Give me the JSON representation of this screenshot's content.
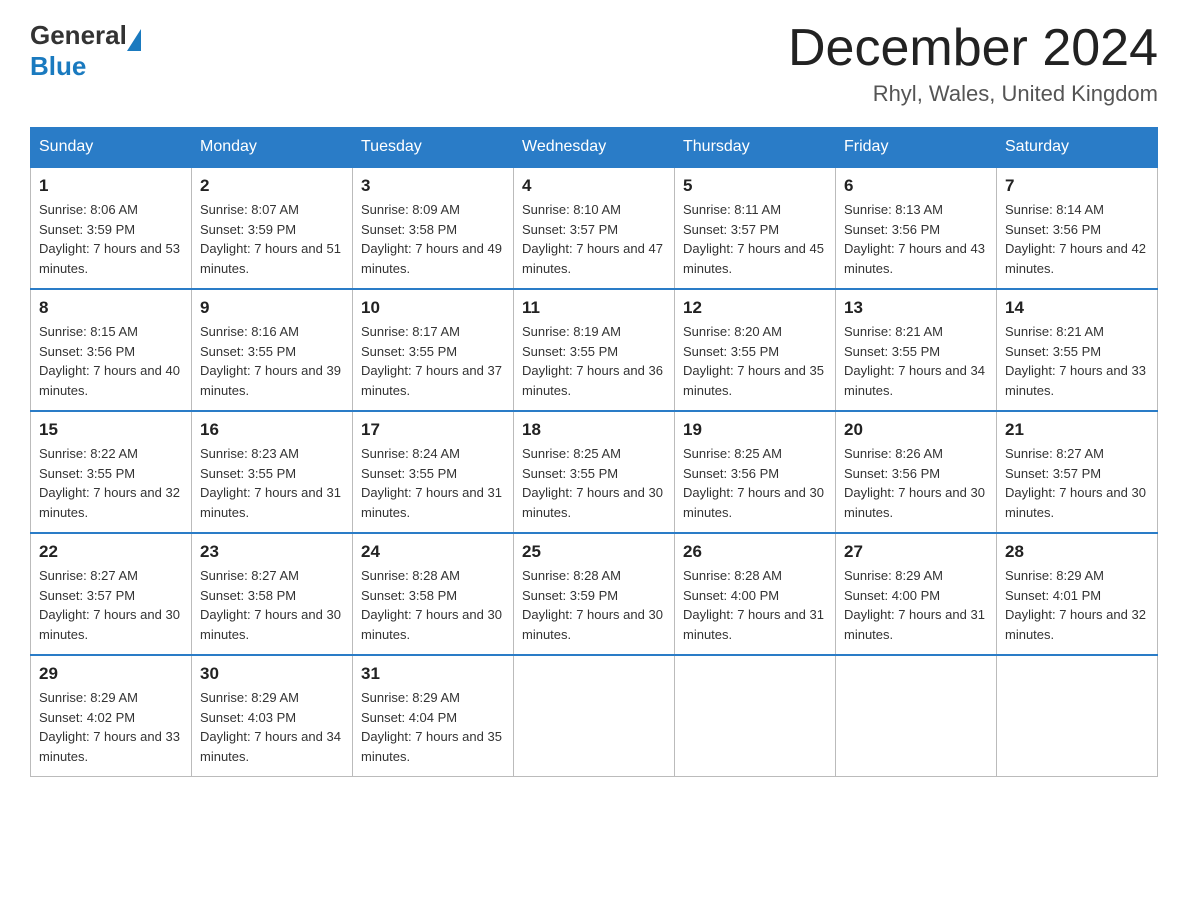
{
  "header": {
    "logo_general": "General",
    "logo_blue": "Blue",
    "month_title": "December 2024",
    "location": "Rhyl, Wales, United Kingdom"
  },
  "weekdays": [
    "Sunday",
    "Monday",
    "Tuesday",
    "Wednesday",
    "Thursday",
    "Friday",
    "Saturday"
  ],
  "weeks": [
    [
      {
        "day": "1",
        "sunrise": "8:06 AM",
        "sunset": "3:59 PM",
        "daylight": "7 hours and 53 minutes."
      },
      {
        "day": "2",
        "sunrise": "8:07 AM",
        "sunset": "3:59 PM",
        "daylight": "7 hours and 51 minutes."
      },
      {
        "day": "3",
        "sunrise": "8:09 AM",
        "sunset": "3:58 PM",
        "daylight": "7 hours and 49 minutes."
      },
      {
        "day": "4",
        "sunrise": "8:10 AM",
        "sunset": "3:57 PM",
        "daylight": "7 hours and 47 minutes."
      },
      {
        "day": "5",
        "sunrise": "8:11 AM",
        "sunset": "3:57 PM",
        "daylight": "7 hours and 45 minutes."
      },
      {
        "day": "6",
        "sunrise": "8:13 AM",
        "sunset": "3:56 PM",
        "daylight": "7 hours and 43 minutes."
      },
      {
        "day": "7",
        "sunrise": "8:14 AM",
        "sunset": "3:56 PM",
        "daylight": "7 hours and 42 minutes."
      }
    ],
    [
      {
        "day": "8",
        "sunrise": "8:15 AM",
        "sunset": "3:56 PM",
        "daylight": "7 hours and 40 minutes."
      },
      {
        "day": "9",
        "sunrise": "8:16 AM",
        "sunset": "3:55 PM",
        "daylight": "7 hours and 39 minutes."
      },
      {
        "day": "10",
        "sunrise": "8:17 AM",
        "sunset": "3:55 PM",
        "daylight": "7 hours and 37 minutes."
      },
      {
        "day": "11",
        "sunrise": "8:19 AM",
        "sunset": "3:55 PM",
        "daylight": "7 hours and 36 minutes."
      },
      {
        "day": "12",
        "sunrise": "8:20 AM",
        "sunset": "3:55 PM",
        "daylight": "7 hours and 35 minutes."
      },
      {
        "day": "13",
        "sunrise": "8:21 AM",
        "sunset": "3:55 PM",
        "daylight": "7 hours and 34 minutes."
      },
      {
        "day": "14",
        "sunrise": "8:21 AM",
        "sunset": "3:55 PM",
        "daylight": "7 hours and 33 minutes."
      }
    ],
    [
      {
        "day": "15",
        "sunrise": "8:22 AM",
        "sunset": "3:55 PM",
        "daylight": "7 hours and 32 minutes."
      },
      {
        "day": "16",
        "sunrise": "8:23 AM",
        "sunset": "3:55 PM",
        "daylight": "7 hours and 31 minutes."
      },
      {
        "day": "17",
        "sunrise": "8:24 AM",
        "sunset": "3:55 PM",
        "daylight": "7 hours and 31 minutes."
      },
      {
        "day": "18",
        "sunrise": "8:25 AM",
        "sunset": "3:55 PM",
        "daylight": "7 hours and 30 minutes."
      },
      {
        "day": "19",
        "sunrise": "8:25 AM",
        "sunset": "3:56 PM",
        "daylight": "7 hours and 30 minutes."
      },
      {
        "day": "20",
        "sunrise": "8:26 AM",
        "sunset": "3:56 PM",
        "daylight": "7 hours and 30 minutes."
      },
      {
        "day": "21",
        "sunrise": "8:27 AM",
        "sunset": "3:57 PM",
        "daylight": "7 hours and 30 minutes."
      }
    ],
    [
      {
        "day": "22",
        "sunrise": "8:27 AM",
        "sunset": "3:57 PM",
        "daylight": "7 hours and 30 minutes."
      },
      {
        "day": "23",
        "sunrise": "8:27 AM",
        "sunset": "3:58 PM",
        "daylight": "7 hours and 30 minutes."
      },
      {
        "day": "24",
        "sunrise": "8:28 AM",
        "sunset": "3:58 PM",
        "daylight": "7 hours and 30 minutes."
      },
      {
        "day": "25",
        "sunrise": "8:28 AM",
        "sunset": "3:59 PM",
        "daylight": "7 hours and 30 minutes."
      },
      {
        "day": "26",
        "sunrise": "8:28 AM",
        "sunset": "4:00 PM",
        "daylight": "7 hours and 31 minutes."
      },
      {
        "day": "27",
        "sunrise": "8:29 AM",
        "sunset": "4:00 PM",
        "daylight": "7 hours and 31 minutes."
      },
      {
        "day": "28",
        "sunrise": "8:29 AM",
        "sunset": "4:01 PM",
        "daylight": "7 hours and 32 minutes."
      }
    ],
    [
      {
        "day": "29",
        "sunrise": "8:29 AM",
        "sunset": "4:02 PM",
        "daylight": "7 hours and 33 minutes."
      },
      {
        "day": "30",
        "sunrise": "8:29 AM",
        "sunset": "4:03 PM",
        "daylight": "7 hours and 34 minutes."
      },
      {
        "day": "31",
        "sunrise": "8:29 AM",
        "sunset": "4:04 PM",
        "daylight": "7 hours and 35 minutes."
      },
      null,
      null,
      null,
      null
    ]
  ]
}
